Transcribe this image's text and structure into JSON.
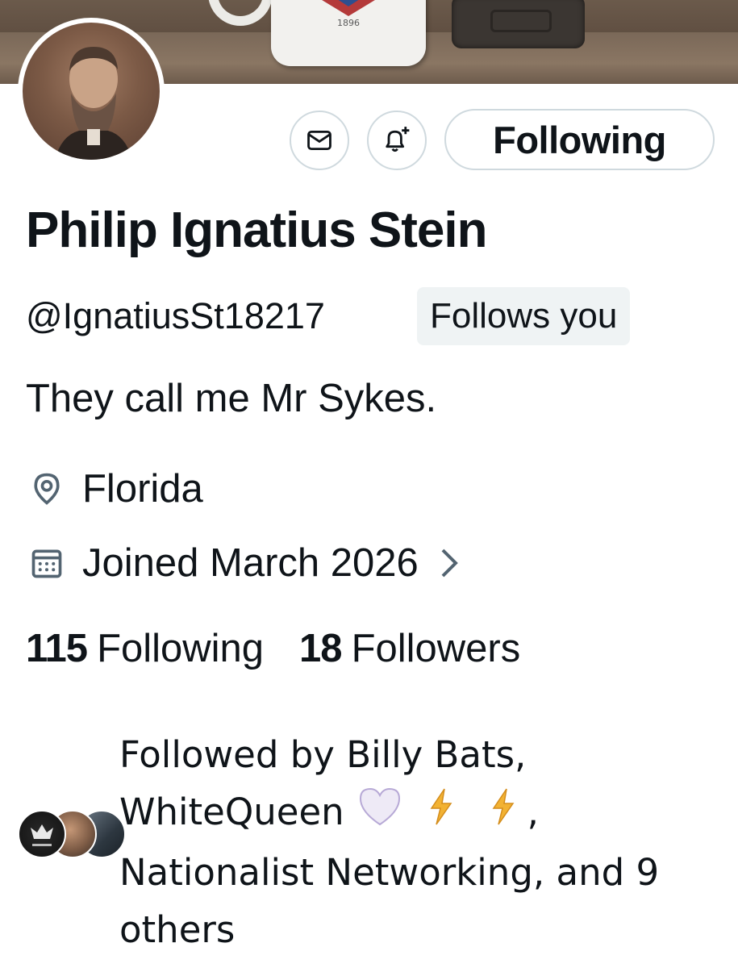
{
  "banner": {
    "mug_year": "1896"
  },
  "profile": {
    "name": "Philip Ignatius Stein",
    "handle": "@IgnatiusSt18217",
    "follows_you": "Follows you",
    "bio": "They call me Mr Sykes.",
    "location": "Florida",
    "joined": "Joined March 2026"
  },
  "actions": {
    "message_icon": "mail-icon",
    "notify_icon": "bell-plus-icon",
    "following_label": "Following"
  },
  "stats": {
    "following_count": "115",
    "following_label": "Following",
    "followers_count": "18",
    "followers_label": "Followers"
  },
  "mutuals": {
    "line1": "Followed by Billy Bats,",
    "line2_name": "WhiteQueen",
    "line2_emoji": [
      "white-heart",
      "lightning",
      "lightning"
    ],
    "line2_suffix": ",",
    "line3": "Nationalist Networking, and 9",
    "line4": "others"
  },
  "colors": {
    "text": "#0f1419",
    "secondary": "#536471",
    "border": "#cfd9de",
    "badge_bg": "#eff3f4"
  }
}
